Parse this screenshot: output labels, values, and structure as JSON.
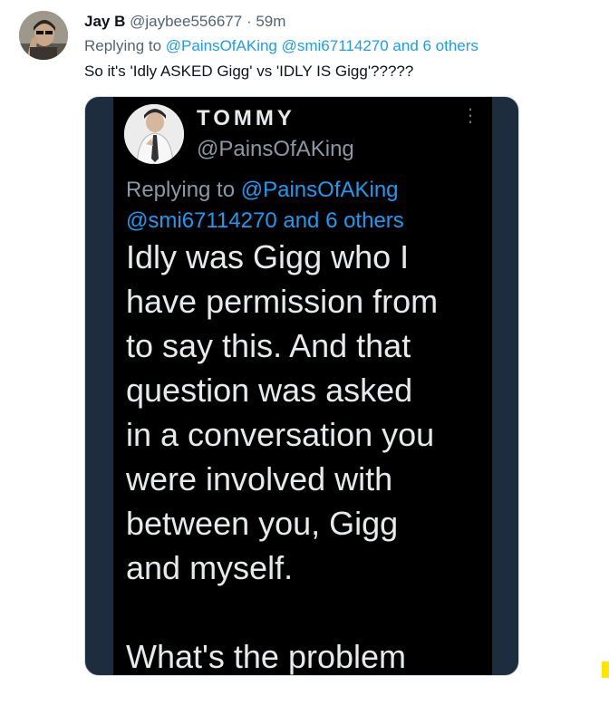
{
  "tweet": {
    "display_name": "Jay B",
    "handle": "@jaybee556677",
    "separator": "·",
    "time": "59m",
    "reply_prefix": "Replying to",
    "reply_mentions": "@PainsOfAKing @smi67114270 and 6 others",
    "text": "So it's 'Idly ASKED Gigg' vs 'IDLY IS Gigg'?????"
  },
  "media": {
    "author_name": "TOMMY",
    "author_handle": "@PainsOfAKing",
    "more_icon": "more-vertical-icon",
    "reply_prefix": "Replying to",
    "reply_mention_1": "@PainsOfAKing",
    "reply_mention_2": "@smi67114270 and 6 others",
    "body": "Idly was Gigg who I\nhave permission from\nto say this. And that\nquestion was asked\nin a conversation you\nwere involved with\nbetween you, Gigg\nand myself.\n\nWhat's the problem"
  },
  "colors": {
    "accent": "#1d9bf0",
    "secondary_text": "#536471",
    "dark_background": "#000000",
    "media_backdrop": "#1e2d3d"
  }
}
